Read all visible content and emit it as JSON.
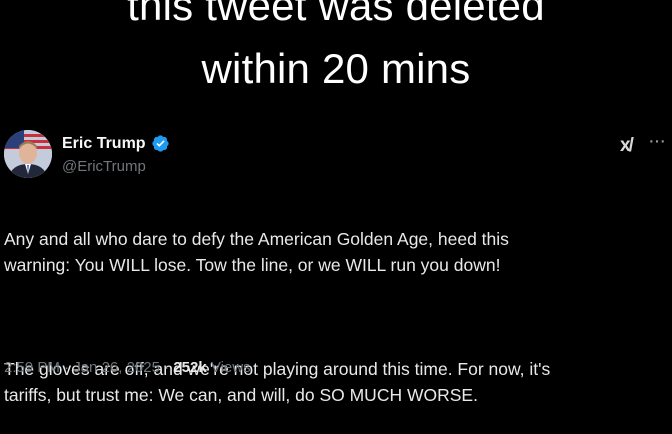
{
  "caption": {
    "line1": "this tweet was deleted",
    "line2": "within 20 mins"
  },
  "tweet": {
    "author_name": "Eric Trump",
    "handle": "@EricTrump",
    "verified_icon": "verified-badge-icon",
    "paragraph1": "Any and all who dare to defy the American Golden Age, heed this\nwarning: You WILL lose. Tow the line, or we WILL run you down!",
    "paragraph2": "The gloves are off, and we're not playing around this time. For now, it's\ntariffs, but trust me: We can, and will, do SO MUCH WORSE.",
    "time": "2:59 PM",
    "sep1": " · ",
    "date": "Jan 26, 2025",
    "sep2": " · ",
    "views_count": "252k",
    "views_label": " Views",
    "grok_icon": "grok-icon",
    "more_icon": "more-icon"
  },
  "colors": {
    "background": "#000000",
    "text": "#e7e9ea",
    "muted": "#71767b",
    "verified": "#1d9bf0"
  }
}
